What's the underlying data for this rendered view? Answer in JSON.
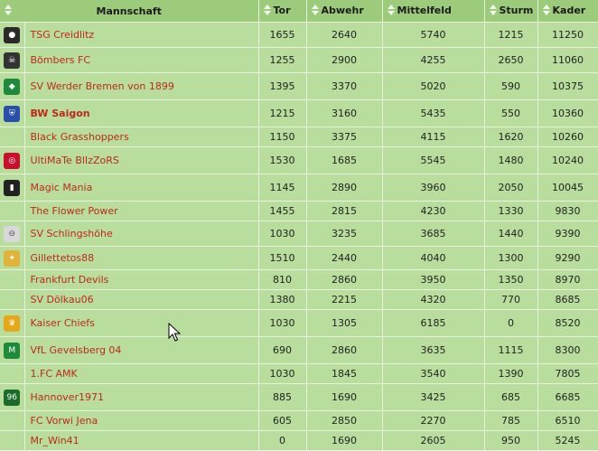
{
  "columns": {
    "team": "Mannschaft",
    "tor": "Tor",
    "abwehr": "Abwehr",
    "mittelfeld": "Mittelfeld",
    "sturm": "Sturm",
    "kader": "Kader"
  },
  "rows": [
    {
      "name": "TSG Creidlitz",
      "tor": "1655",
      "abwehr": "2640",
      "mittelfeld": "5740",
      "sturm": "1215",
      "kader": "11250",
      "logo": "crest-icon",
      "logo_color": "#2a2a2a",
      "bold": false
    },
    {
      "name": "Bömbers FC",
      "tor": "1255",
      "abwehr": "2900",
      "mittelfeld": "4255",
      "sturm": "2650",
      "kader": "11060",
      "logo": "skull-icon",
      "logo_color": "#333333",
      "bold": false
    },
    {
      "name": "SV Werder Bremen von 1899",
      "tor": "1395",
      "abwehr": "3370",
      "mittelfeld": "5020",
      "sturm": "590",
      "kader": "10375",
      "logo": "werder-diamond-icon",
      "logo_color": "#1d8a3c",
      "bold": false
    },
    {
      "name": "BW Saigon",
      "tor": "1215",
      "abwehr": "3160",
      "mittelfeld": "5435",
      "sturm": "550",
      "kader": "10360",
      "logo": "shield-icon",
      "logo_color": "#2a4fa8",
      "bold": true
    },
    {
      "name": "Black Grasshoppers",
      "tor": "1150",
      "abwehr": "3375",
      "mittelfeld": "4115",
      "sturm": "1620",
      "kader": "10260",
      "logo": "",
      "logo_color": "",
      "bold": false
    },
    {
      "name": "UltiMaTe BlIzZoRS",
      "tor": "1530",
      "abwehr": "1685",
      "mittelfeld": "5545",
      "sturm": "1480",
      "kader": "10240",
      "logo": "bayern-crest-icon",
      "logo_color": "#c8102e",
      "bold": false
    },
    {
      "name": "Magic Mania",
      "tor": "1145",
      "abwehr": "2890",
      "mittelfeld": "3960",
      "sturm": "2050",
      "kader": "10045",
      "logo": "juventus-crest-icon",
      "logo_color": "#222222",
      "bold": false
    },
    {
      "name": "The Flower Power",
      "tor": "1455",
      "abwehr": "2815",
      "mittelfeld": "4230",
      "sturm": "1330",
      "kader": "9830",
      "logo": "",
      "logo_color": "",
      "bold": false
    },
    {
      "name": "SV Schlingshöhe",
      "tor": "1030",
      "abwehr": "3235",
      "mittelfeld": "3685",
      "sturm": "1440",
      "kader": "9390",
      "logo": "opel-logo-icon",
      "logo_color": "#d9d9d9",
      "bold": false
    },
    {
      "name": "Gillettetos88",
      "tor": "1510",
      "abwehr": "2440",
      "mittelfeld": "4040",
      "sturm": "1300",
      "kader": "9290",
      "logo": "mascot-icon",
      "logo_color": "#e2b33a",
      "bold": false
    },
    {
      "name": "Frankfurt Devils",
      "tor": "810",
      "abwehr": "2860",
      "mittelfeld": "3950",
      "sturm": "1350",
      "kader": "8970",
      "logo": "",
      "logo_color": "",
      "bold": false
    },
    {
      "name": "SV Dölkau06",
      "tor": "1380",
      "abwehr": "2215",
      "mittelfeld": "4320",
      "sturm": "770",
      "kader": "8685",
      "logo": "",
      "logo_color": "",
      "bold": false
    },
    {
      "name": "Kaiser Chiefs",
      "tor": "1030",
      "abwehr": "1305",
      "mittelfeld": "6185",
      "sturm": "0",
      "kader": "8520",
      "logo": "kaiser-chiefs-crest-icon",
      "logo_color": "#e5a81a",
      "bold": false
    },
    {
      "name": "VfL Gevelsberg 04",
      "tor": "690",
      "abwehr": "2860",
      "mittelfeld": "3635",
      "sturm": "1115",
      "kader": "8300",
      "logo": "gladbach-crest-icon",
      "logo_color": "#1d8a3c",
      "bold": false
    },
    {
      "name": "1.FC AMK",
      "tor": "1030",
      "abwehr": "1845",
      "mittelfeld": "3540",
      "sturm": "1390",
      "kader": "7805",
      "logo": "",
      "logo_color": "",
      "bold": false
    },
    {
      "name": "Hannover1971",
      "tor": "885",
      "abwehr": "1690",
      "mittelfeld": "3425",
      "sturm": "685",
      "kader": "6685",
      "logo": "hannover-96-icon",
      "logo_color": "#1a6b2c",
      "bold": false
    },
    {
      "name": "FC Vorwi Jena",
      "tor": "605",
      "abwehr": "2850",
      "mittelfeld": "2270",
      "sturm": "785",
      "kader": "6510",
      "logo": "",
      "logo_color": "",
      "bold": false
    },
    {
      "name": "Mr_Win41",
      "tor": "0",
      "abwehr": "1690",
      "mittelfeld": "2605",
      "sturm": "950",
      "kader": "5245",
      "logo": "",
      "logo_color": "",
      "bold": false
    }
  ],
  "row_heights": [
    28,
    28,
    30,
    30,
    22,
    30,
    30,
    22,
    28,
    26,
    22,
    22,
    30,
    30,
    22,
    30,
    22,
    22
  ]
}
